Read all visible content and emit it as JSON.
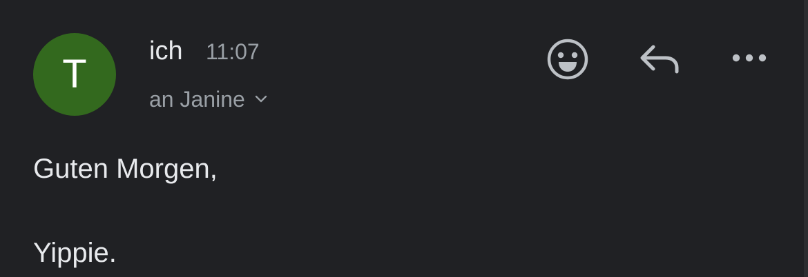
{
  "message": {
    "avatar_letter": "T",
    "avatar_color": "#33691e",
    "sender": "ich",
    "time": "11:07",
    "recipient": "an Janine",
    "recipient_expand_icon": "chevron-down-icon",
    "body_lines": [
      "Guten Morgen,",
      "Yippie."
    ]
  },
  "actions": {
    "emoji_icon": "smiley-icon",
    "reply_icon": "reply-arrow-icon",
    "more_icon": "more-horizontal-icon"
  },
  "colors": {
    "background": "#202124",
    "primary_text": "#e8eaed",
    "secondary_text": "#9aa0a6"
  }
}
